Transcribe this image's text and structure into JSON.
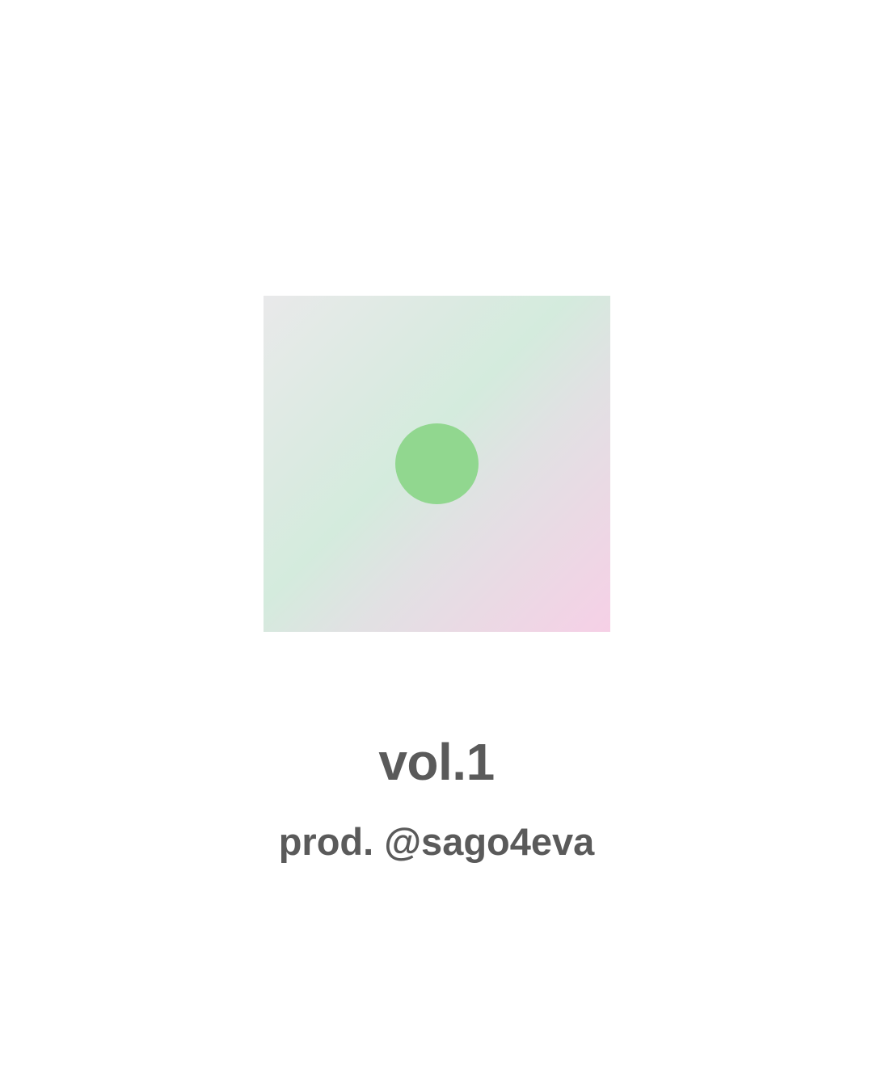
{
  "cover": {
    "dot_icon": "circle-icon",
    "dot_color": "#91d78f"
  },
  "title": "vol.1",
  "subtitle": "prod. @sago4eva"
}
